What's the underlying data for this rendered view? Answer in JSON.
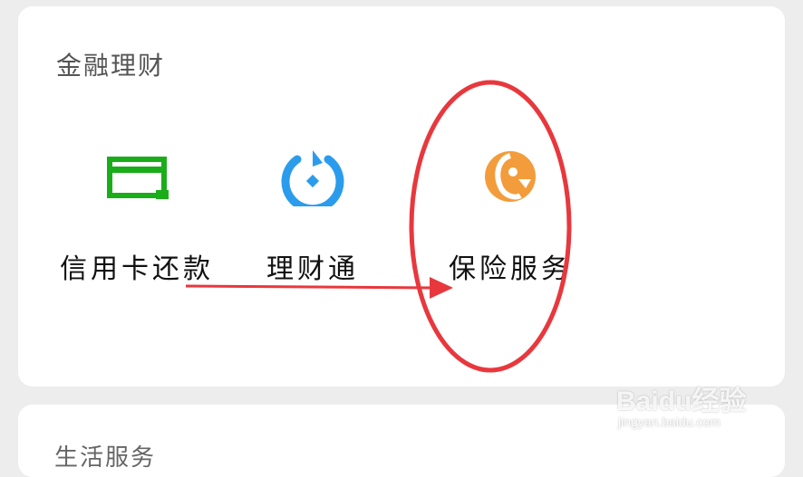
{
  "section": {
    "title": "金融理财"
  },
  "services": [
    {
      "label": "信用卡还款",
      "icon": "credit-card-icon",
      "color": "#1aad19"
    },
    {
      "label": "理财通",
      "icon": "licaitong-icon",
      "color": "#2b9cec"
    },
    {
      "label": "保险服务",
      "icon": "insurance-icon",
      "color": "#f39c3b"
    }
  ],
  "next_section": {
    "title": "生活服务"
  },
  "annotation": {
    "color": "#e8383d"
  },
  "watermark": {
    "brand": "Baidu经验",
    "url": "jingyan.baidu.com"
  }
}
